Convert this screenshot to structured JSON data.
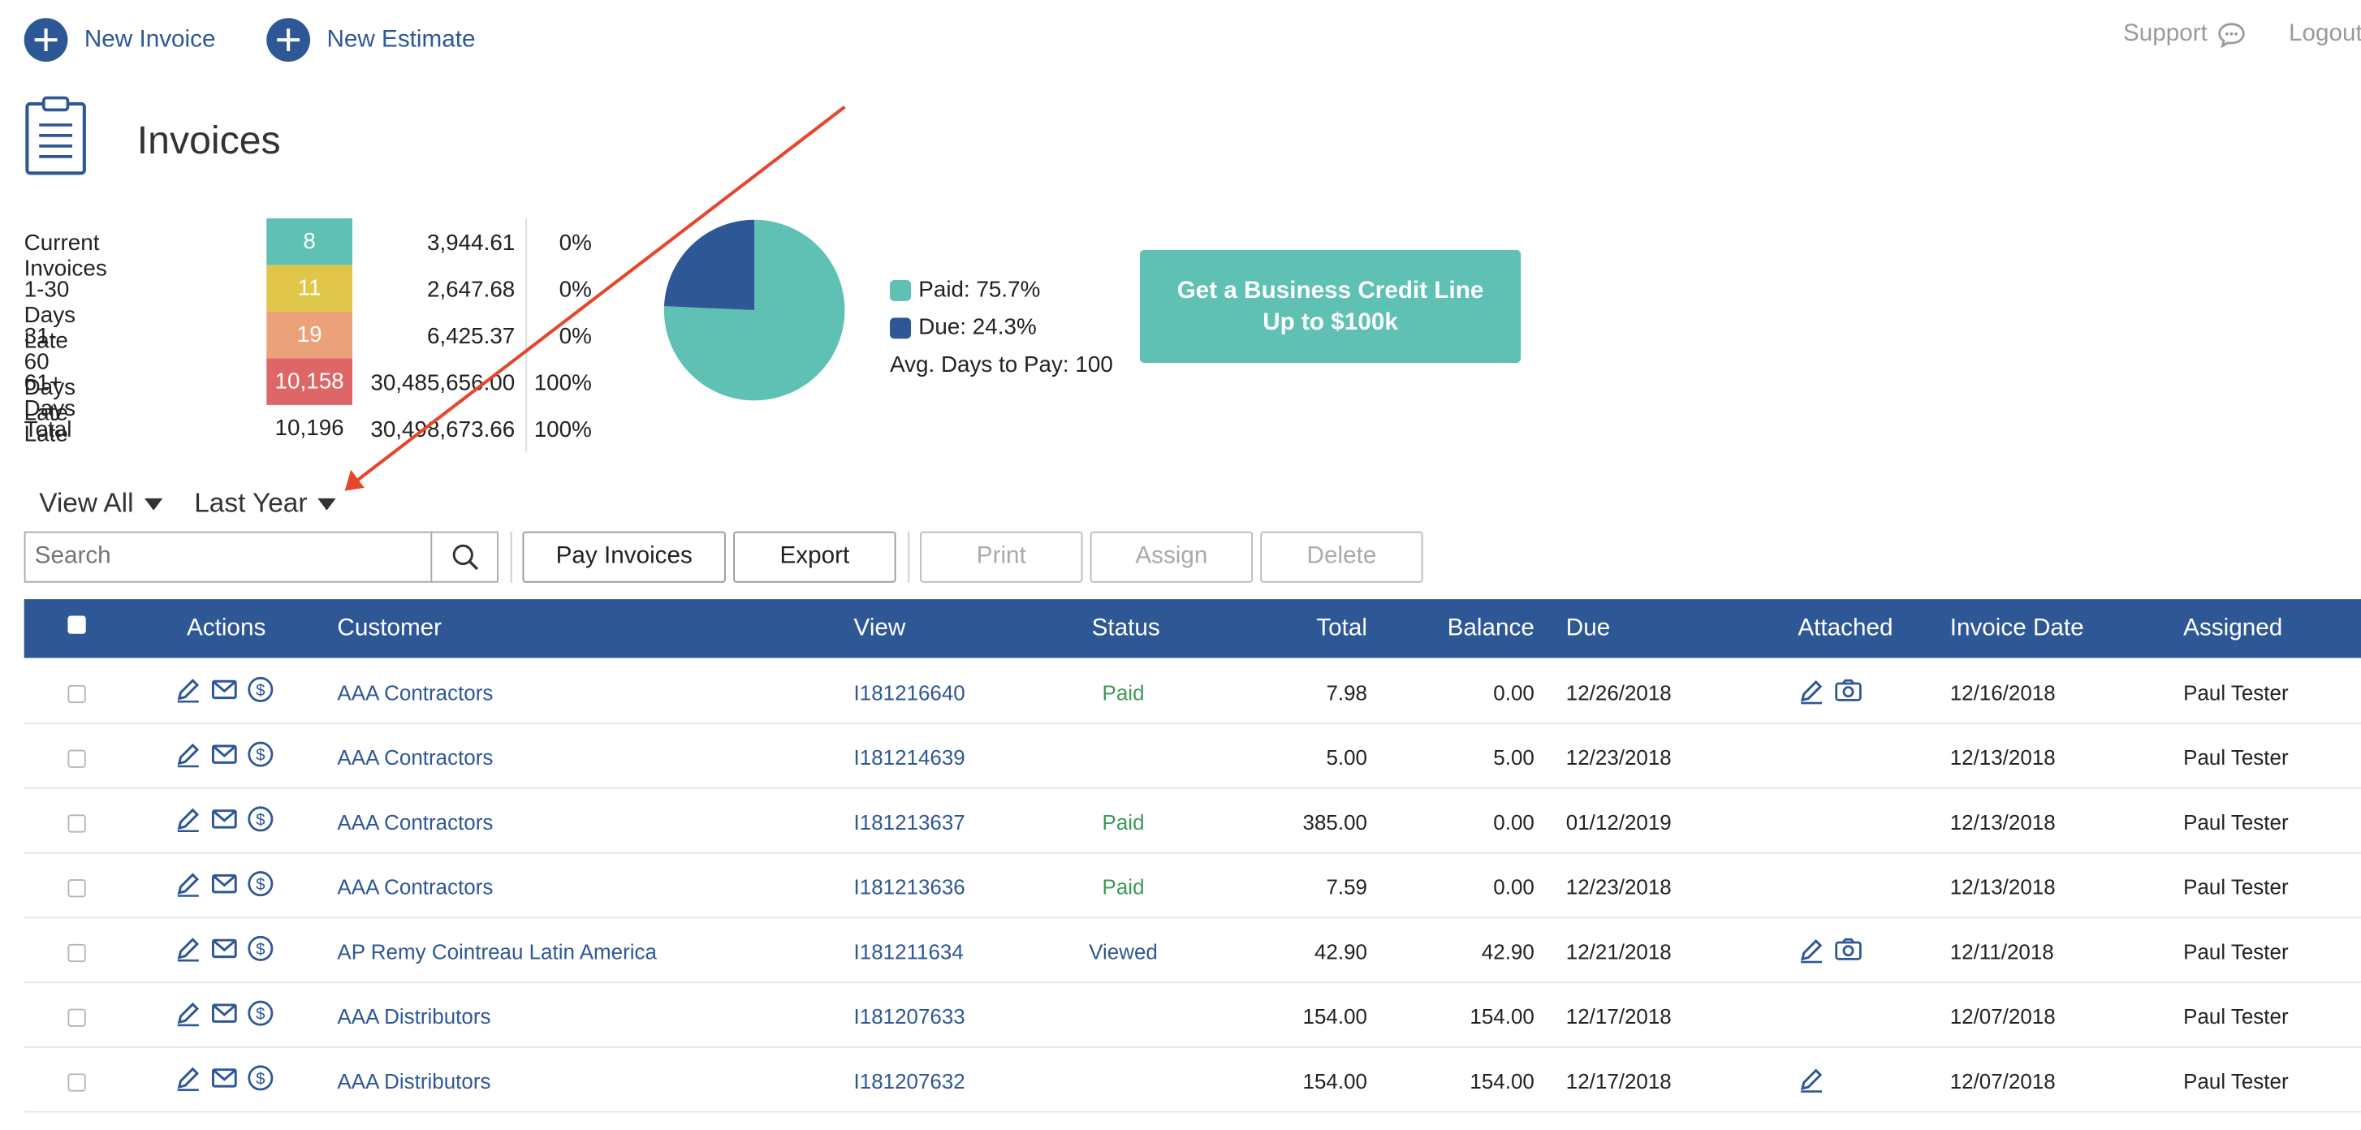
{
  "header": {
    "new_invoice": "New Invoice",
    "new_estimate": "New Estimate",
    "support": "Support",
    "logout": "Logout"
  },
  "page": {
    "title": "Invoices"
  },
  "summary": [
    {
      "label": "Current Invoices",
      "count": "8",
      "amount": "3,944.61",
      "percent": "0%",
      "color": "#5fc0b4"
    },
    {
      "label": "1-30 Days Late",
      "count": "11",
      "amount": "2,647.68",
      "percent": "0%",
      "color": "#e0c74a"
    },
    {
      "label": "31-60 Days Late",
      "count": "19",
      "amount": "6,425.37",
      "percent": "0%",
      "color": "#eba27a"
    },
    {
      "label": "61+ Days Late",
      "count": "10,158",
      "amount": "30,485,656.00",
      "percent": "100%",
      "color": "#dd6766"
    }
  ],
  "total": {
    "label": "Total",
    "count": "10,196",
    "amount": "30,498,673.66",
    "percent": "100%"
  },
  "pie": {
    "paid_label": "Paid: 75.7%",
    "due_label": "Due: 24.3%",
    "avg_days": "Avg. Days to Pay: 100",
    "paid_fraction": 0.757,
    "paid_color": "#5fc0b4",
    "due_color": "#2e5796"
  },
  "cta": {
    "line1": "Get a Business Credit Line",
    "line2": "Up to $100k"
  },
  "filters": {
    "view": "View All",
    "period": "Last Year"
  },
  "toolbar": {
    "search_placeholder": "Search",
    "pay": "Pay Invoices",
    "export": "Export",
    "print": "Print",
    "assign": "Assign",
    "delete": "Delete"
  },
  "table": {
    "headers": {
      "actions": "Actions",
      "customer": "Customer",
      "view": "View",
      "status": "Status",
      "total": "Total",
      "balance": "Balance",
      "due": "Due",
      "attached": "Attached",
      "invoice_date": "Invoice Date",
      "assigned": "Assigned"
    },
    "rows": [
      {
        "customer": "AAA Contractors",
        "view": "I181216640",
        "status": "Paid",
        "total": "7.98",
        "balance": "0.00",
        "due": "12/26/2018",
        "attached_edit": true,
        "attached_camera": true,
        "invoice_date": "12/16/2018",
        "assigned": "Paul Tester"
      },
      {
        "customer": "AAA Contractors",
        "view": "I181214639",
        "status": "",
        "total": "5.00",
        "balance": "5.00",
        "due": "12/23/2018",
        "attached_edit": false,
        "attached_camera": false,
        "invoice_date": "12/13/2018",
        "assigned": "Paul Tester"
      },
      {
        "customer": "AAA Contractors",
        "view": "I181213637",
        "status": "Paid",
        "total": "385.00",
        "balance": "0.00",
        "due": "01/12/2019",
        "attached_edit": false,
        "attached_camera": false,
        "invoice_date": "12/13/2018",
        "assigned": "Paul Tester"
      },
      {
        "customer": "AAA Contractors",
        "view": "I181213636",
        "status": "Paid",
        "total": "7.59",
        "balance": "0.00",
        "due": "12/23/2018",
        "attached_edit": false,
        "attached_camera": false,
        "invoice_date": "12/13/2018",
        "assigned": "Paul Tester"
      },
      {
        "customer": "AP Remy Cointreau Latin America",
        "view": "I181211634",
        "status": "Viewed",
        "total": "42.90",
        "balance": "42.90",
        "due": "12/21/2018",
        "attached_edit": true,
        "attached_camera": true,
        "invoice_date": "12/11/2018",
        "assigned": "Paul Tester"
      },
      {
        "customer": "AAA Distributors",
        "view": "I181207633",
        "status": "",
        "total": "154.00",
        "balance": "154.00",
        "due": "12/17/2018",
        "attached_edit": false,
        "attached_camera": false,
        "invoice_date": "12/07/2018",
        "assigned": "Paul Tester"
      },
      {
        "customer": "AAA Distributors",
        "view": "I181207632",
        "status": "",
        "total": "154.00",
        "balance": "154.00",
        "due": "12/17/2018",
        "attached_edit": true,
        "attached_camera": false,
        "invoice_date": "12/07/2018",
        "assigned": "Paul Tester"
      }
    ]
  },
  "icons": [
    "plus-icon",
    "chat-bubble-icon",
    "clipboard-icon",
    "search-icon",
    "pencil-icon",
    "envelope-icon",
    "dollar-icon",
    "camera-icon",
    "dropdown-caret-icon"
  ]
}
